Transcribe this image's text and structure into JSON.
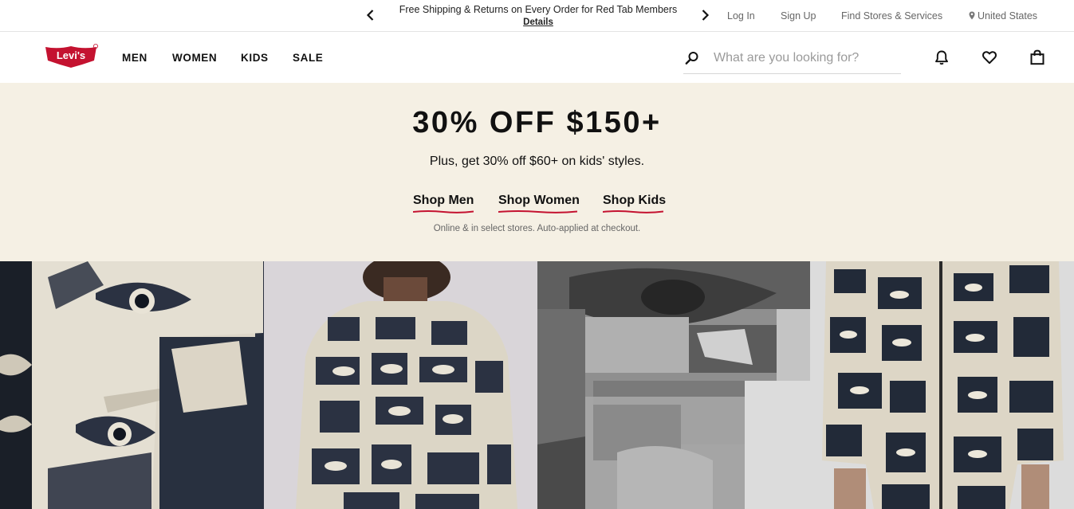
{
  "utility_bar": {
    "promo_text": "Free Shipping & Returns on Every Order for Red Tab Members",
    "promo_link": "Details",
    "links": {
      "login": "Log In",
      "signup": "Sign Up",
      "stores": "Find Stores & Services",
      "country": "United States"
    }
  },
  "header": {
    "logo_text": "Levi's",
    "nav": [
      "MEN",
      "WOMEN",
      "KIDS",
      "SALE"
    ],
    "search_placeholder": "What are you looking for?",
    "icons": [
      "search-icon",
      "bell-icon",
      "heart-icon",
      "bag-icon",
      "location-pin-icon",
      "chevron-left-icon",
      "chevron-right-icon"
    ]
  },
  "hero": {
    "title": "30% OFF $150+",
    "subtitle": "Plus, get 30% off $60+ on kids' styles.",
    "links": [
      "Shop Men",
      "Shop Women",
      "Shop Kids"
    ],
    "note": "Online & in select stores. Auto-applied at checkout.",
    "background": "#f5f0e4",
    "underline_color": "#c41230"
  },
  "brand": {
    "red": "#c41230"
  },
  "tiles": [
    {
      "name": "eye-print-closeup"
    },
    {
      "name": "eye-print-jacket-back"
    },
    {
      "name": "eye-print-fabric-detail"
    },
    {
      "name": "eye-print-jacket-front"
    }
  ]
}
